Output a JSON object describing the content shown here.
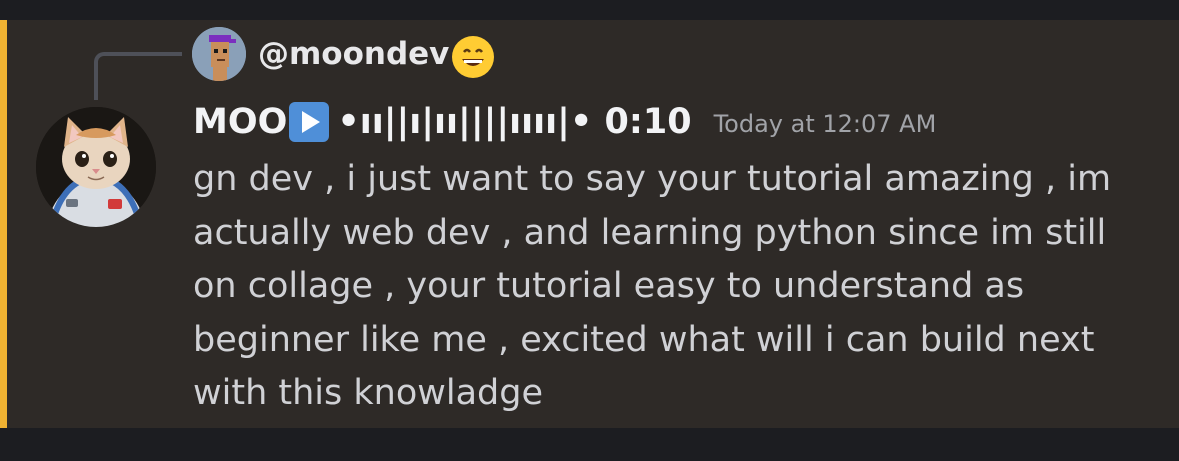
{
  "reply": {
    "username": "@moondev",
    "avatar_icon": "pixel-punk-avatar-icon",
    "emoji_icon": "grinning-face-emoji-icon"
  },
  "message": {
    "author": "MOO",
    "author_badge_icon": "play-button-icon",
    "waveform_text": "•ıı||ı|ıı||||ıııı|•",
    "duration": "0:10",
    "timestamp": "Today at 12:07 AM",
    "avatar_icon": "astronaut-cat-avatar-icon",
    "lines": [
      "gn dev , i just want to say your tutorial amazing , im",
      "actually web dev , and learning python since im still",
      "on collage , your tutorial easy to understand as",
      "beginner like me , excited what will i can build next",
      "with this knowladge"
    ]
  },
  "colors": {
    "accent": "#f0b232",
    "message_bg": "#2e2a27",
    "page_bg": "#1c1d21",
    "badge_blue": "#4f8fd8"
  }
}
